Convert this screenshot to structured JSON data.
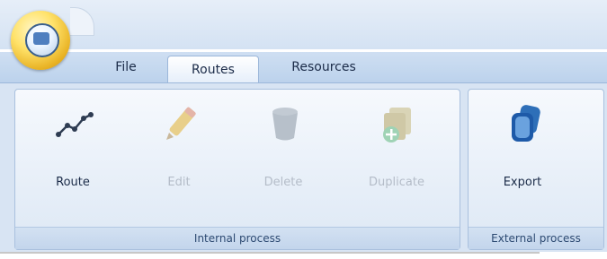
{
  "tabs": [
    "File",
    "Routes",
    "Resources"
  ],
  "active_tab": "Routes",
  "groups": [
    {
      "label": "Internal process",
      "buttons": [
        {
          "label": "Route",
          "icon": "route-icon",
          "enabled": true
        },
        {
          "label": "Edit",
          "icon": "pencil-icon",
          "enabled": false
        },
        {
          "label": "Delete",
          "icon": "trash-icon",
          "enabled": false
        },
        {
          "label": "Duplicate",
          "icon": "duplicate-icon",
          "enabled": false
        }
      ]
    },
    {
      "label": "External process",
      "buttons": [
        {
          "label": "Export",
          "icon": "export-icon",
          "enabled": true
        }
      ]
    }
  ],
  "colors": {
    "accent": "#1e5aa8",
    "orb": "#f0c12f",
    "ribbon_bg": "#d8e4f3"
  }
}
